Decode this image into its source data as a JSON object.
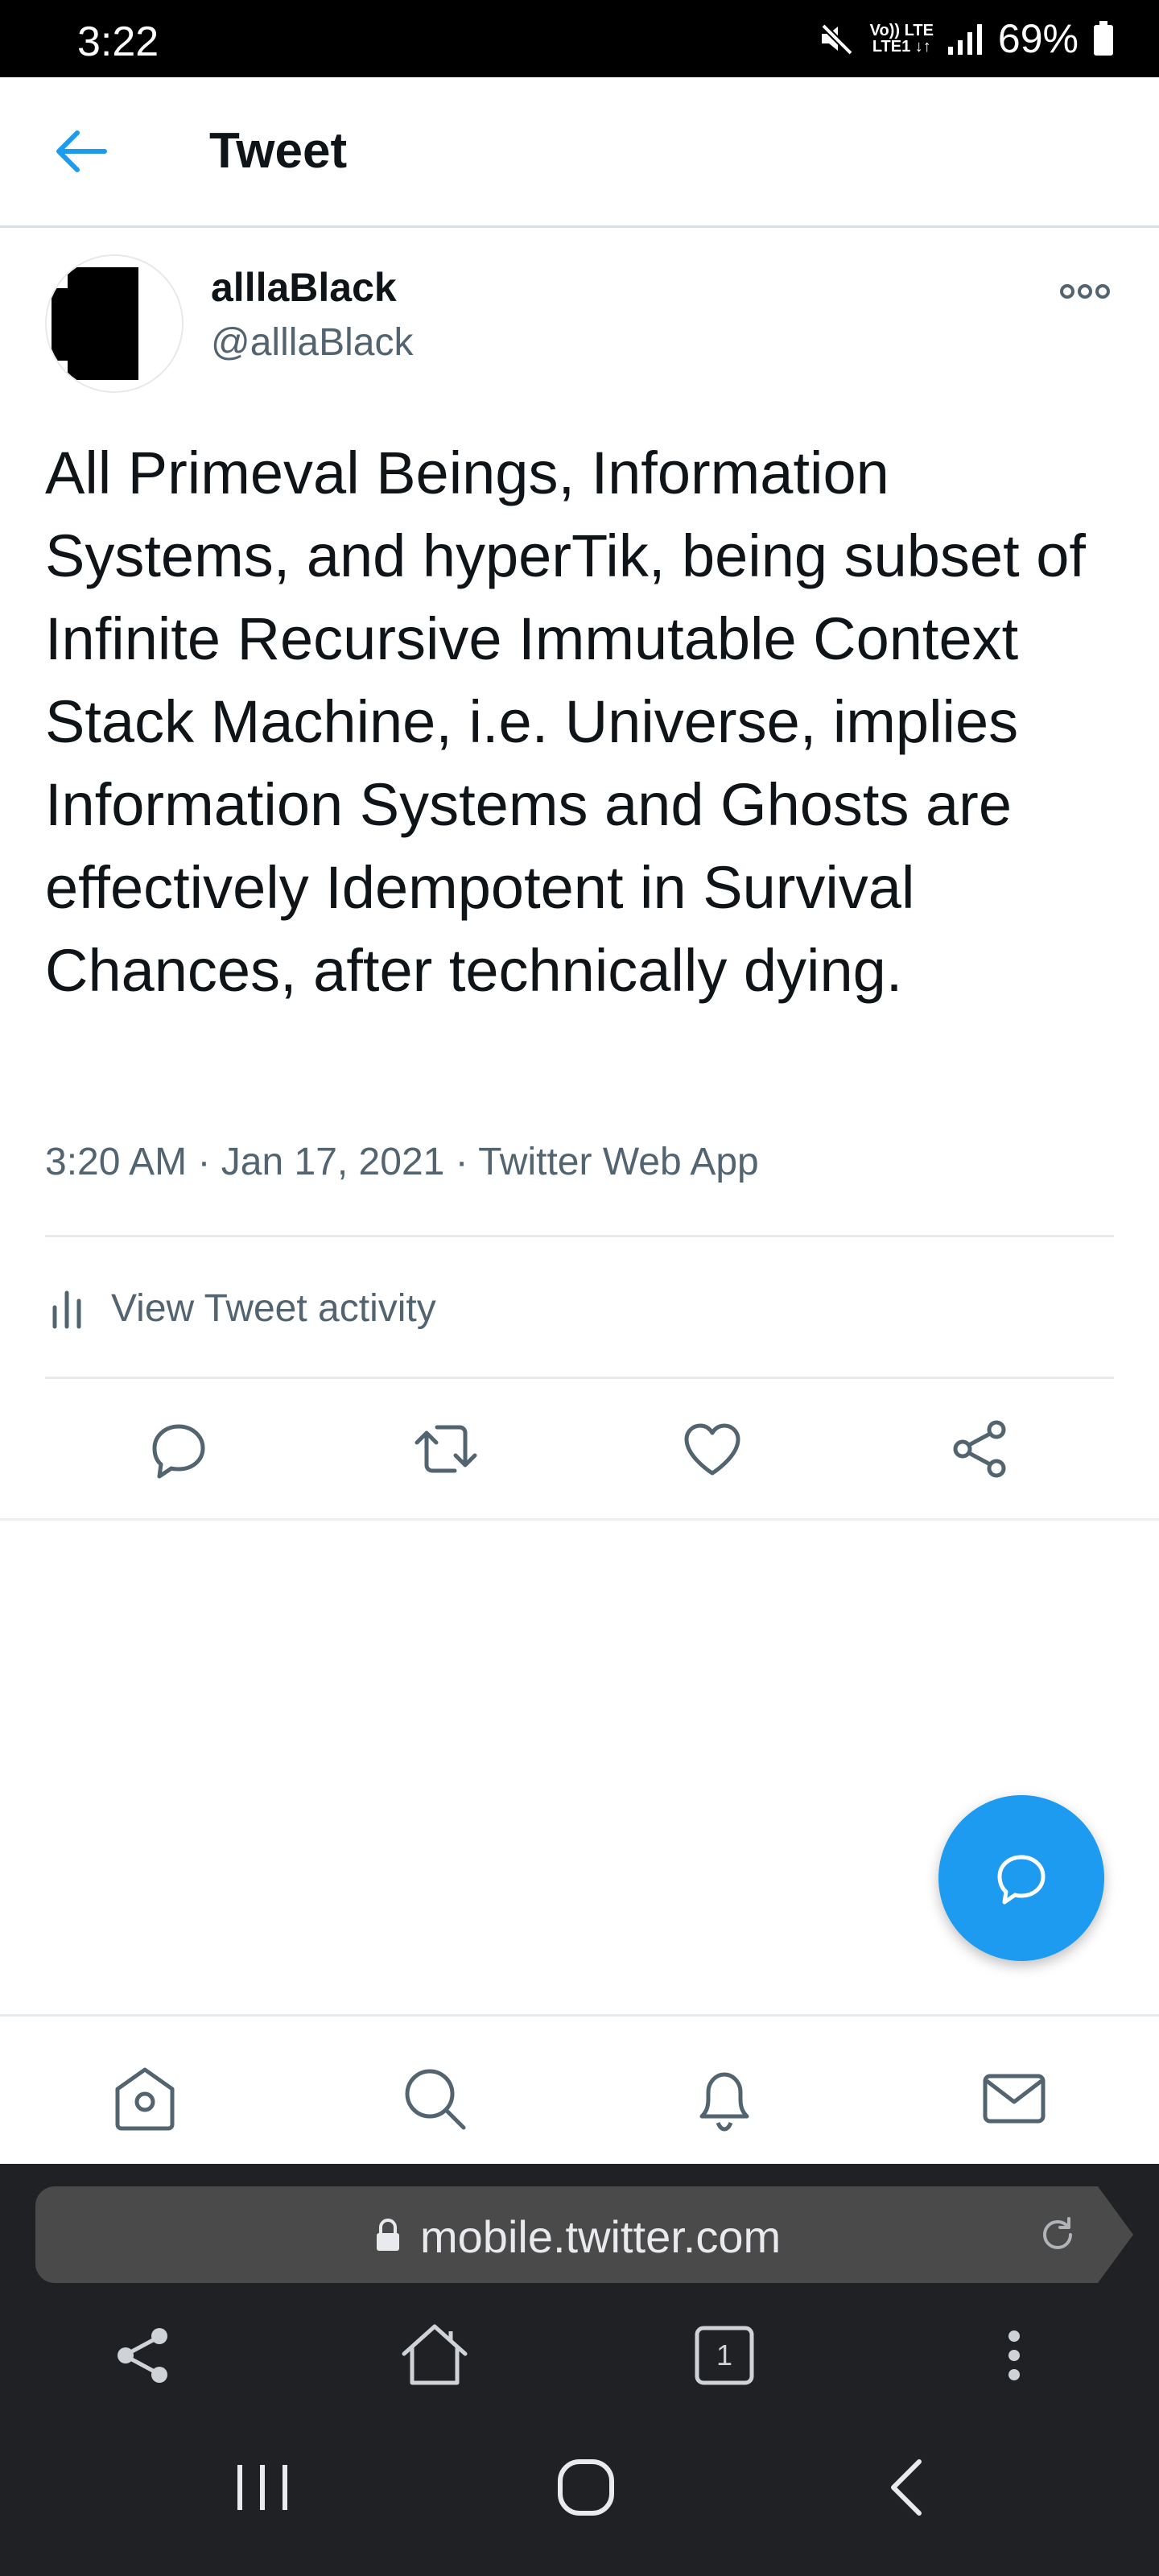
{
  "status_bar": {
    "time": "3:22",
    "network_top": "Vo)) LTE",
    "network_bottom": "LTE1 ↓↑",
    "battery": "69%"
  },
  "header": {
    "title": "Tweet"
  },
  "tweet": {
    "author_name": "alllaBlack",
    "author_handle": "@alllaBlack",
    "text": "All Primeval Beings, Information Systems, and hyperTik, being subset of Infinite Recursive Immutable Context Stack Machine, i.e. Universe, implies Information Systems and Ghosts are effectively Idempotent in Survival Chances, after technically dying.",
    "meta": "3:20 AM · Jan 17, 2021 · Twitter Web App",
    "activity_label": "View Tweet activity"
  },
  "browser": {
    "url": "mobile.twitter.com",
    "tab_count": "1"
  },
  "colors": {
    "accent": "#1d9bf0",
    "secondary_text": "#536471",
    "icon": "#536471",
    "browser_bg": "#202124"
  },
  "icons": {
    "back": "arrow-left-icon",
    "more": "more-icon",
    "activity": "bar-chart-icon",
    "reply": "reply-icon",
    "retweet": "retweet-icon",
    "like": "heart-icon",
    "share": "share-icon",
    "compose": "compose-reply-icon",
    "home": "home-icon",
    "search": "search-icon",
    "notifications": "bell-icon",
    "messages": "mail-icon"
  }
}
